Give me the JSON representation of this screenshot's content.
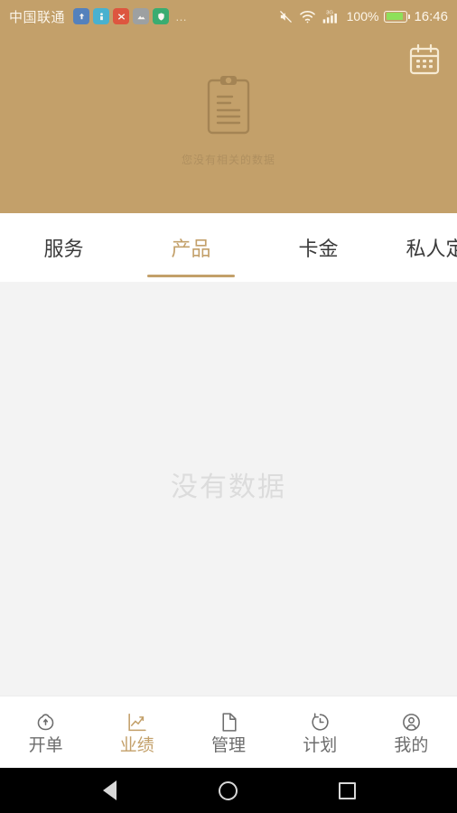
{
  "status_bar": {
    "carrier": "中国联通",
    "notif_icons": [
      "app-badge-blue",
      "app-badge-cyan",
      "app-badge-red",
      "app-badge-gray",
      "app-badge-green"
    ],
    "more_icon": "…",
    "mute_icon": "mute-icon",
    "wifi_icon": "wifi-icon",
    "signal_icon": "signal-3g-icon",
    "network_label": "3G",
    "battery_percent": "100%",
    "battery_icon": "battery-charging-icon",
    "time": "16:46"
  },
  "header": {
    "background_color": "#C3A06A",
    "calendar_icon": "calendar-icon",
    "empty_icon": "clipboard-icon",
    "empty_text": "您没有相关的数据"
  },
  "tabs": {
    "accent_color": "#C3A06A",
    "items": [
      {
        "label": "服务",
        "active": false
      },
      {
        "label": "产品",
        "active": true
      },
      {
        "label": "卡金",
        "active": false
      },
      {
        "label": "私人定制",
        "active": false
      }
    ]
  },
  "content": {
    "empty_text": "没有数据",
    "background_color": "#f3f3f3"
  },
  "bottom_nav": {
    "active_color": "#C3A06A",
    "inactive_color": "#6d6d6d",
    "items": [
      {
        "label": "开单",
        "icon": "purse-icon",
        "active": false
      },
      {
        "label": "业绩",
        "icon": "chart-line-icon",
        "active": true
      },
      {
        "label": "管理",
        "icon": "document-icon",
        "active": false
      },
      {
        "label": "计划",
        "icon": "clock-icon",
        "active": false
      },
      {
        "label": "我的",
        "icon": "user-circle-icon",
        "active": false
      }
    ]
  },
  "system_nav": {
    "back_icon": "back-triangle-icon",
    "home_icon": "home-circle-icon",
    "recents_icon": "recents-square-icon"
  }
}
